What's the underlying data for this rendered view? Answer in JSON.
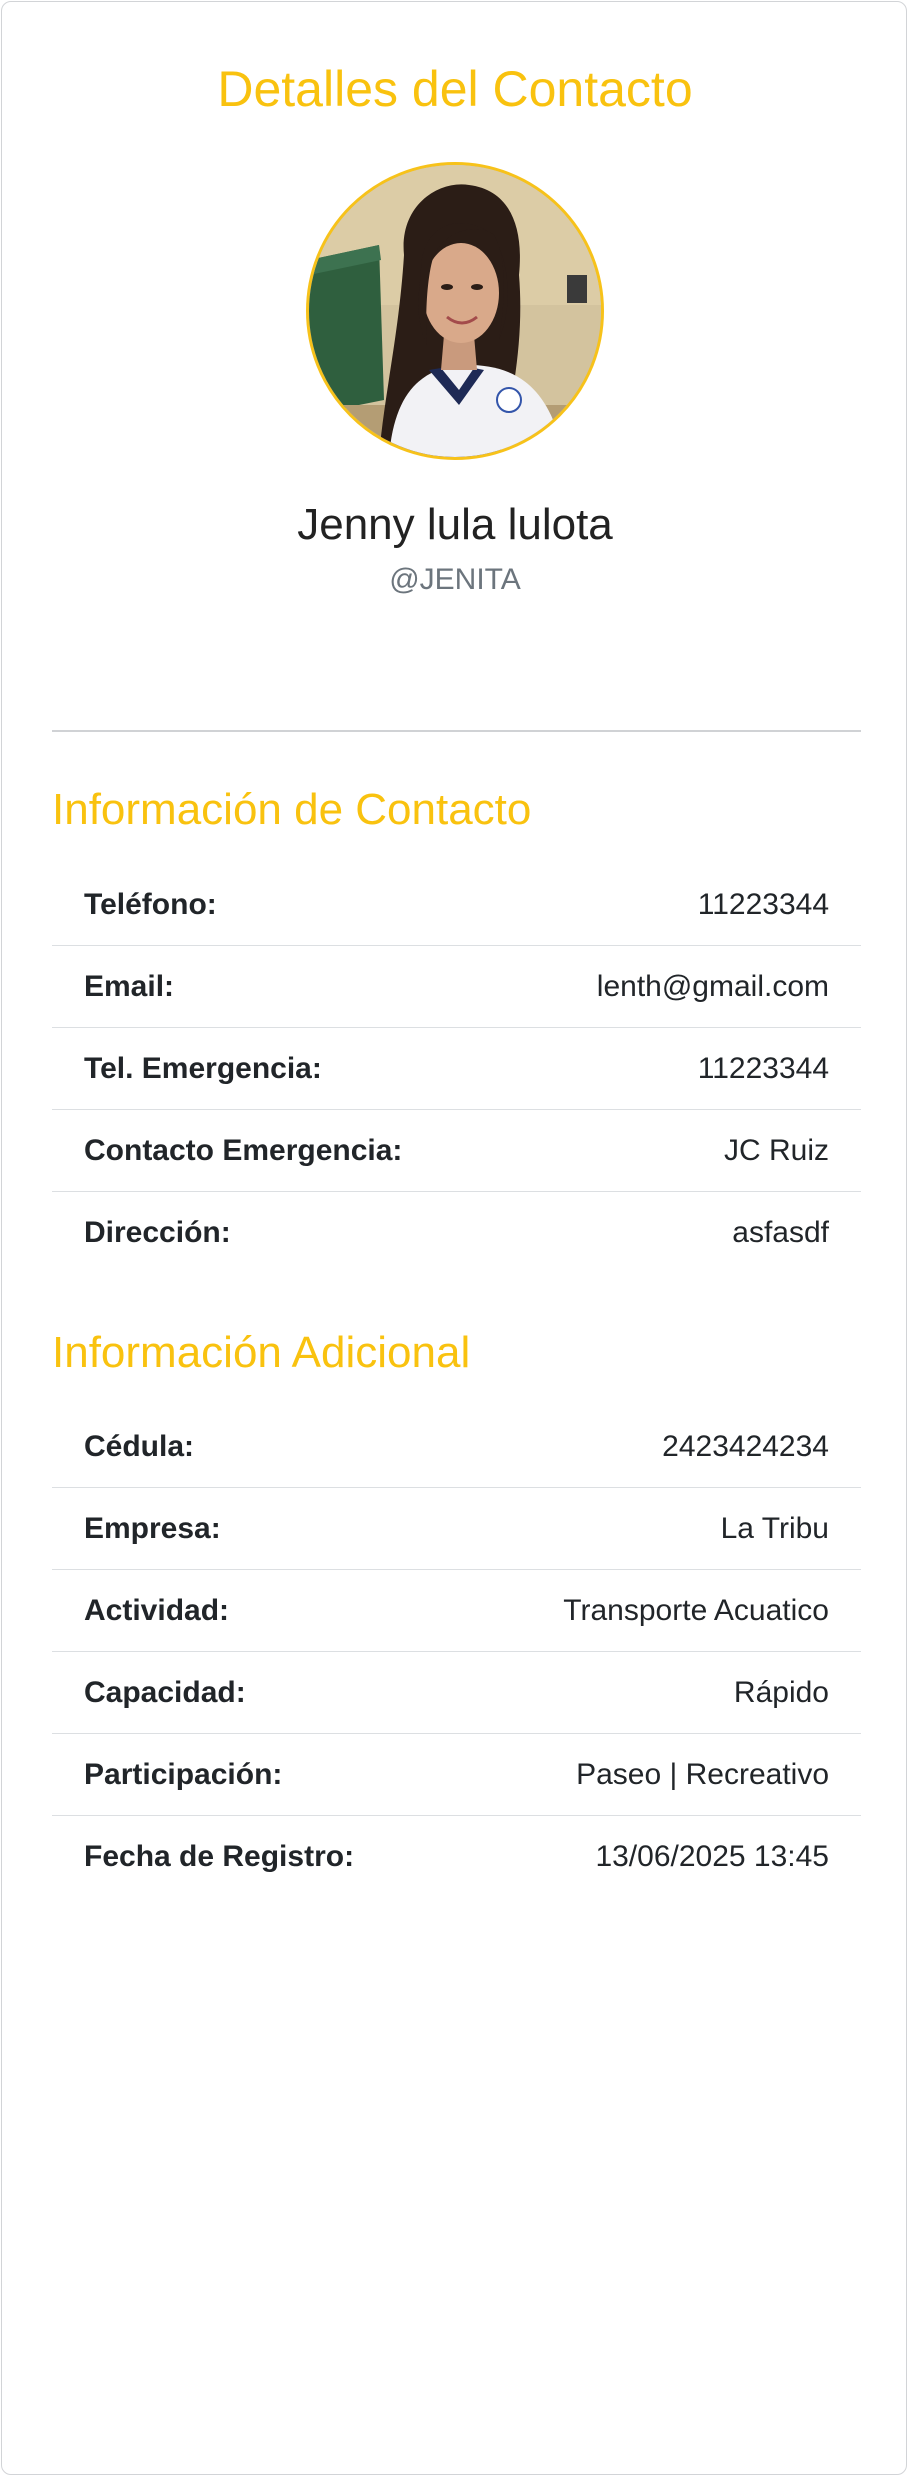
{
  "header": {
    "title": "Detalles del Contacto"
  },
  "profile": {
    "photo": "profile-photo",
    "name": "Jenny lula lulota",
    "username": "@JENITA"
  },
  "contact_info": {
    "title": "Información de Contacto",
    "rows": [
      {
        "label": "Teléfono:",
        "value": "11223344"
      },
      {
        "label": "Email:",
        "value": "lenth@gmail.com"
      },
      {
        "label": "Tel. Emergencia:",
        "value": "11223344"
      },
      {
        "label": "Contacto Emergencia:",
        "value": "JC Ruiz"
      },
      {
        "label": "Dirección:",
        "value": "asfasdf"
      }
    ]
  },
  "additional_info": {
    "title": "Información Adicional",
    "rows": [
      {
        "label": "Cédula:",
        "value": "2423424234"
      },
      {
        "label": "Empresa:",
        "value": "La Tribu"
      },
      {
        "label": "Actividad:",
        "value": "Transporte Acuatico"
      },
      {
        "label": "Capacidad:",
        "value": "Rápido"
      },
      {
        "label": "Participación:",
        "value": "Paseo | Recreativo"
      },
      {
        "label": "Fecha de Registro:",
        "value": "13/06/2025 13:45"
      }
    ]
  },
  "colors": {
    "accent": "#f9c20f",
    "text": "#212529",
    "muted": "#6c757d",
    "border": "#dcdfe2"
  }
}
